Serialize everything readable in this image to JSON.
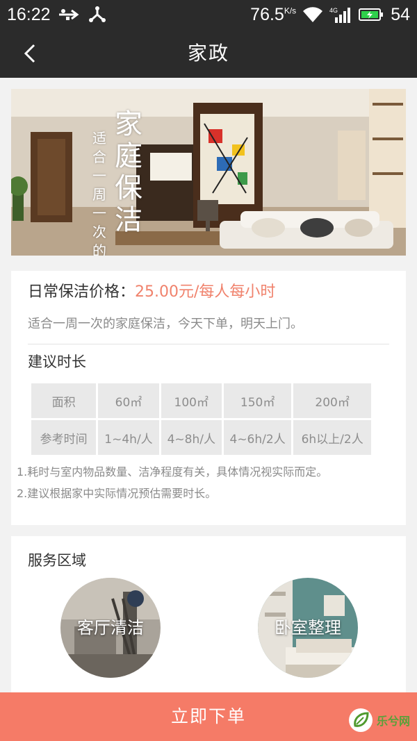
{
  "status_bar": {
    "time": "16:22",
    "speed": "76.5",
    "speed_unit": "K/s",
    "network": "4G",
    "battery": "54",
    "icons": [
      "usb-icon",
      "share-icon",
      "wifi-icon",
      "signal-icon",
      "battery-icon"
    ]
  },
  "nav": {
    "back_icon": "chevron-left-icon",
    "title": "家政"
  },
  "banner": {
    "big_text": "家庭保洁",
    "vertical_text": "适合一周一次的"
  },
  "price": {
    "label": "日常保洁价格：",
    "value": "25.00元/每人每小时",
    "value_color": "#f0826c",
    "description": "适合一周一次的家庭保洁，今天下单，明天上门。"
  },
  "duration": {
    "title": "建议时长",
    "rows": [
      [
        "面积",
        "60㎡",
        "100㎡",
        "150㎡",
        "200㎡"
      ],
      [
        "参考时间",
        "1~4h/人",
        "4~8h/人",
        "4~6h/2人",
        "6h以上/2人"
      ]
    ],
    "notes": [
      "1.耗时与室内物品数量、洁净程度有关，具体情况视实际而定。",
      "2.建议根据家中实际情况预估需要时长。"
    ]
  },
  "service_area": {
    "title": "服务区域",
    "items": [
      {
        "label": "客厅清洁"
      },
      {
        "label": "卧室整理"
      }
    ]
  },
  "action": {
    "order_label": "立即下单",
    "color": "#f57b67"
  },
  "watermark": {
    "text": "乐兮网"
  }
}
